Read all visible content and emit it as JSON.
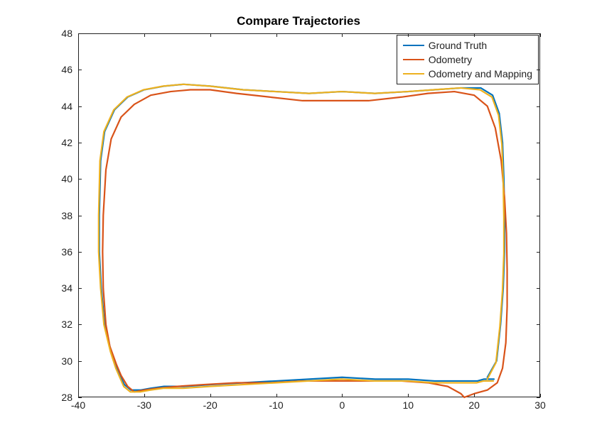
{
  "chart_data": {
    "type": "line",
    "title": "Compare Trajectories",
    "xlabel": "",
    "ylabel": "",
    "xlim": [
      -40,
      30
    ],
    "ylim": [
      28,
      48
    ],
    "xticks": [
      -40,
      -30,
      -20,
      -10,
      0,
      10,
      20,
      30
    ],
    "yticks": [
      28,
      30,
      32,
      34,
      36,
      38,
      40,
      42,
      44,
      46,
      48
    ],
    "legend_position": "northeast",
    "series": [
      {
        "name": "Ground Truth",
        "color": "#0072BD",
        "x": [
          22.0,
          23.4,
          24.0,
          24.4,
          24.6,
          24.6,
          24.5,
          24.3,
          23.8,
          22.8,
          21.0,
          18.0,
          14.0,
          10.0,
          5.0,
          0.0,
          -5.0,
          -10.0,
          -15.0,
          -20.0,
          -24.0,
          -27.0,
          -30.0,
          -32.5,
          -34.5,
          -36.0,
          -36.6,
          -36.8,
          -36.8,
          -36.5,
          -36.0,
          -35.0,
          -34.2,
          -33.0,
          -32.0,
          -30.5,
          -29.0,
          -27.0,
          -24.0,
          -20.0,
          -15.0,
          -10.0,
          -5.0,
          0.0,
          5.0,
          10.0,
          14.0,
          17.0,
          19.0,
          20.5,
          21.5,
          22.0,
          22.4,
          23.0
        ],
        "y": [
          29.1,
          30.0,
          32.0,
          34.0,
          36.0,
          38.0,
          40.0,
          42.0,
          43.6,
          44.6,
          45.0,
          45.0,
          44.9,
          44.8,
          44.7,
          44.8,
          44.7,
          44.8,
          44.9,
          45.1,
          45.2,
          45.1,
          44.9,
          44.5,
          43.8,
          42.6,
          41.0,
          38.0,
          36.0,
          34.0,
          32.0,
          30.5,
          29.6,
          28.7,
          28.4,
          28.4,
          28.5,
          28.6,
          28.6,
          28.7,
          28.8,
          28.9,
          29.0,
          29.1,
          29.0,
          29.0,
          28.9,
          28.9,
          28.9,
          28.9,
          29.0,
          29.0,
          29.0,
          29.0
        ]
      },
      {
        "name": "Odometry",
        "color": "#D95319",
        "x": [
          18.5,
          20.0,
          22.0,
          23.5,
          24.3,
          24.8,
          25.0,
          25.0,
          24.9,
          24.6,
          24.1,
          23.2,
          22.0,
          20.0,
          17.0,
          13.0,
          9.0,
          4.0,
          -1.0,
          -6.0,
          -11.0,
          -16.0,
          -20.0,
          -23.0,
          -26.0,
          -29.0,
          -31.5,
          -33.5,
          -35.0,
          -35.8,
          -36.2,
          -36.3,
          -36.2,
          -35.8,
          -35.2,
          -34.2,
          -33.5,
          -32.5,
          -31.5,
          -30.0,
          -28.0,
          -25.0,
          -21.0,
          -16.0,
          -11.0,
          -6.0,
          -1.0,
          4.0,
          9.0,
          13.0,
          16.0,
          18.0,
          18.5
        ],
        "y": [
          28.0,
          28.2,
          28.4,
          28.8,
          29.6,
          31.0,
          33.0,
          35.0,
          37.0,
          39.0,
          41.0,
          42.8,
          44.0,
          44.6,
          44.8,
          44.7,
          44.5,
          44.3,
          44.3,
          44.3,
          44.5,
          44.7,
          44.9,
          44.9,
          44.8,
          44.6,
          44.1,
          43.4,
          42.2,
          40.5,
          38.0,
          36.0,
          34.0,
          32.0,
          30.8,
          29.8,
          29.2,
          28.6,
          28.3,
          28.4,
          28.5,
          28.6,
          28.7,
          28.8,
          28.8,
          28.9,
          28.9,
          28.9,
          28.9,
          28.8,
          28.6,
          28.2,
          28.0
        ]
      },
      {
        "name": "Odometry and Mapping",
        "color": "#EDB120",
        "x": [
          22.0,
          23.3,
          23.9,
          24.3,
          24.5,
          24.5,
          24.4,
          24.2,
          23.7,
          22.7,
          20.9,
          17.9,
          13.9,
          9.9,
          4.9,
          -0.1,
          -5.1,
          -10.1,
          -15.1,
          -20.1,
          -24.1,
          -27.1,
          -30.1,
          -32.6,
          -34.6,
          -36.1,
          -36.7,
          -36.9,
          -36.9,
          -36.6,
          -36.1,
          -35.1,
          -34.3,
          -33.1,
          -32.1,
          -30.6,
          -29.1,
          -27.1,
          -24.1,
          -20.1,
          -15.1,
          -10.1,
          -5.1,
          -0.1,
          4.9,
          9.9,
          13.9,
          16.9,
          18.9,
          20.4,
          21.4,
          21.9,
          22.3,
          22.9
        ],
        "y": [
          29.0,
          29.9,
          31.9,
          33.9,
          35.9,
          37.9,
          39.9,
          41.9,
          43.5,
          44.5,
          44.9,
          45.0,
          44.9,
          44.8,
          44.7,
          44.8,
          44.7,
          44.8,
          44.9,
          45.1,
          45.2,
          45.1,
          44.9,
          44.5,
          43.8,
          42.6,
          41.0,
          38.0,
          36.0,
          34.0,
          32.0,
          30.5,
          29.6,
          28.6,
          28.3,
          28.3,
          28.4,
          28.5,
          28.5,
          28.6,
          28.7,
          28.8,
          28.9,
          29.0,
          28.9,
          28.9,
          28.8,
          28.8,
          28.8,
          28.8,
          28.9,
          28.9,
          28.9,
          28.9
        ]
      }
    ]
  }
}
